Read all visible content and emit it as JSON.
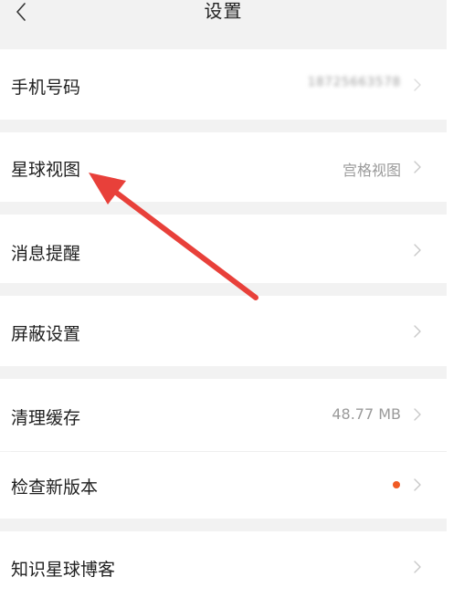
{
  "header": {
    "title": "设置"
  },
  "rows": [
    {
      "label": "手机号码",
      "value": "18725663578"
    },
    {
      "label": "星球视图",
      "value": "宫格视图"
    },
    {
      "label": "消息提醒",
      "value": ""
    },
    {
      "label": "屏蔽设置",
      "value": ""
    },
    {
      "label": "清理缓存",
      "value": "48.77 MB"
    },
    {
      "label": "检查新版本",
      "value": ""
    },
    {
      "label": "知识星球博客",
      "value": ""
    }
  ],
  "colors": {
    "background": "#f2f2f2",
    "row": "#ffffff",
    "label": "#1f1f1f",
    "secondary": "#9a9a9a",
    "chevron": "#c8c8c8",
    "update_dot": "#f05a24",
    "annotation_arrow": "#e8403a"
  },
  "icons": {
    "back": "chevron-left-icon",
    "row_chevron": "chevron-right-icon"
  }
}
